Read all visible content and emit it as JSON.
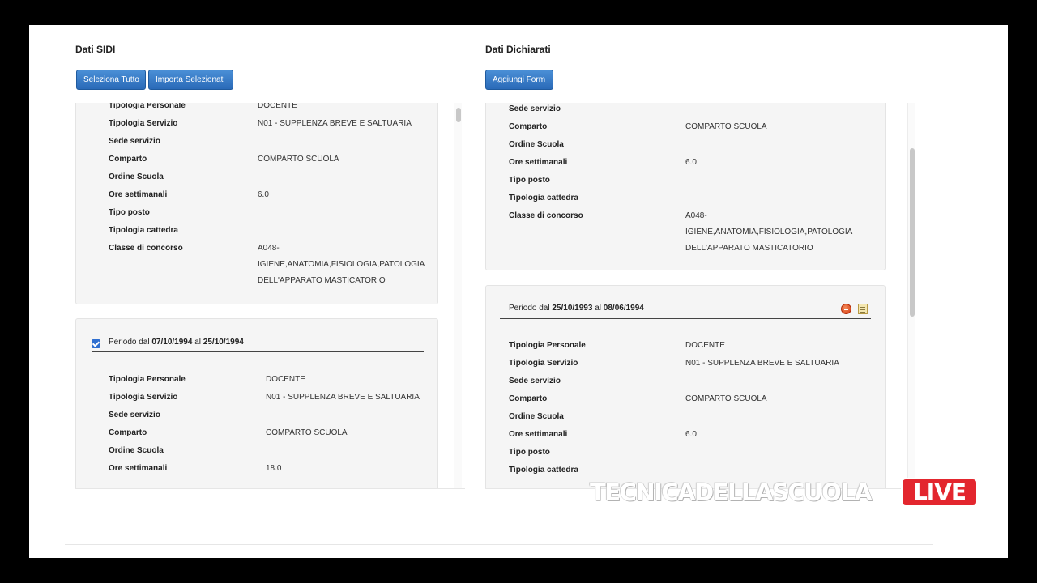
{
  "left": {
    "title": "Dati SIDI",
    "buttons": {
      "select_all": "Seleziona Tutto",
      "import_selected": "Importa Selezionati"
    },
    "card1": {
      "fields": [
        {
          "label": "Tipologia Personale",
          "value": "DOCENTE"
        },
        {
          "label": "Tipologia Servizio",
          "value": "N01 - SUPPLENZA BREVE E SALTUARIA"
        },
        {
          "label": "Sede servizio",
          "value": ""
        },
        {
          "label": "Comparto",
          "value": "COMPARTO SCUOLA"
        },
        {
          "label": "Ordine Scuola",
          "value": ""
        },
        {
          "label": "Ore settimanali",
          "value": "6.0"
        },
        {
          "label": "Tipo posto",
          "value": ""
        },
        {
          "label": "Tipologia cattedra",
          "value": ""
        },
        {
          "label": "Classe di concorso",
          "value_lines": [
            "A048-",
            "IGIENE,ANATOMIA,FISIOLOGIA,PATOLOGIA",
            "DELL'APPARATO MASTICATORIO"
          ]
        }
      ]
    },
    "card2": {
      "checked": true,
      "period": {
        "prefix": "Periodo dal",
        "from": "07/10/1994",
        "mid": "al",
        "to": "25/10/1994"
      },
      "fields": [
        {
          "label": "Tipologia Personale",
          "value": "DOCENTE"
        },
        {
          "label": "Tipologia Servizio",
          "value": "N01 - SUPPLENZA BREVE E SALTUARIA"
        },
        {
          "label": "Sede servizio",
          "value": ""
        },
        {
          "label": "Comparto",
          "value": "COMPARTO SCUOLA"
        },
        {
          "label": "Ordine Scuola",
          "value": ""
        },
        {
          "label": "Ore settimanali",
          "value": "18.0"
        }
      ]
    }
  },
  "right": {
    "title": "Dati Dichiarati",
    "buttons": {
      "add_form": "Aggiungi Form"
    },
    "card1": {
      "fields": [
        {
          "label": "Sede servizio",
          "value": ""
        },
        {
          "label": "Comparto",
          "value": "COMPARTO SCUOLA"
        },
        {
          "label": "Ordine Scuola",
          "value": ""
        },
        {
          "label": "Ore settimanali",
          "value": "6.0"
        },
        {
          "label": "Tipo posto",
          "value": ""
        },
        {
          "label": "Tipologia cattedra",
          "value": ""
        },
        {
          "label": "Classe di concorso",
          "value_lines": [
            "A048-",
            "IGIENE,ANATOMIA,FISIOLOGIA,PATOLOGIA",
            "DELL'APPARATO MASTICATORIO"
          ]
        }
      ]
    },
    "card2": {
      "period": {
        "prefix": "Periodo dal",
        "from": "25/10/1993",
        "mid": "al",
        "to": "08/06/1994"
      },
      "fields": [
        {
          "label": "Tipologia Personale",
          "value": "DOCENTE"
        },
        {
          "label": "Tipologia Servizio",
          "value": "N01 - SUPPLENZA BREVE E SALTUARIA"
        },
        {
          "label": "Sede servizio",
          "value": ""
        },
        {
          "label": "Comparto",
          "value": "COMPARTO SCUOLA"
        },
        {
          "label": "Ordine Scuola",
          "value": ""
        },
        {
          "label": "Ore settimanali",
          "value": "6.0"
        },
        {
          "label": "Tipo posto",
          "value": ""
        },
        {
          "label": "Tipologia cattedra",
          "value": ""
        }
      ]
    }
  },
  "watermark": {
    "brand": "TECNICADELLASCUOLA",
    "live": "LIVE"
  }
}
